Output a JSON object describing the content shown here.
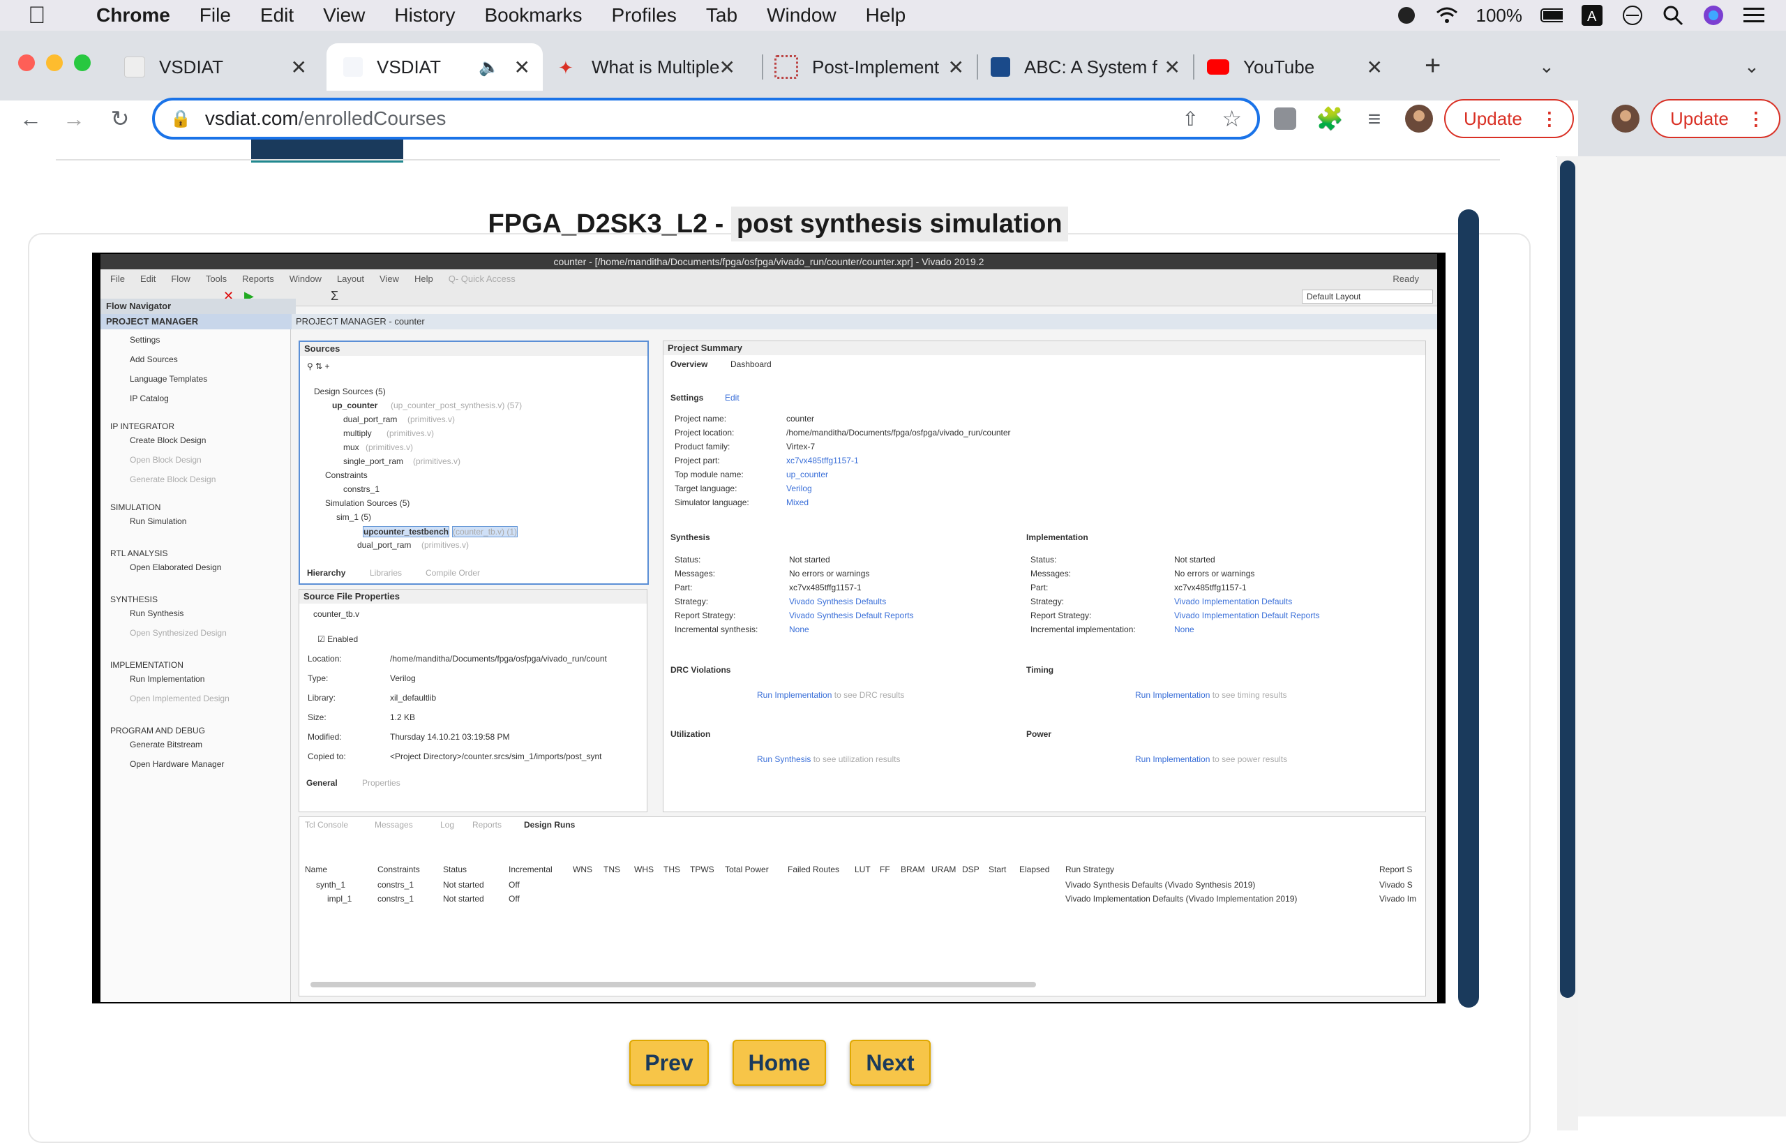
{
  "menubar": {
    "app": "Chrome",
    "items": [
      "File",
      "Edit",
      "View",
      "History",
      "Bookmarks",
      "Profiles",
      "Tab",
      "Window",
      "Help"
    ],
    "battery": "100%"
  },
  "tabs": [
    {
      "title": "VSDIAT",
      "active": false
    },
    {
      "title": "VSDIAT",
      "active": true
    },
    {
      "title": "What is Multiple",
      "active": false
    },
    {
      "title": "Post-Implement",
      "active": false
    },
    {
      "title": "ABC: A System f",
      "active": false
    },
    {
      "title": "YouTube",
      "active": false
    }
  ],
  "address": {
    "domain": "vsdiat.com",
    "path": "/enrolledCourses"
  },
  "update_label": "Update",
  "lesson": {
    "title_prefix": "FPGA_D2SK3_L2 - ",
    "title_highlight": "post synthesis simulation"
  },
  "nav": {
    "prev": "Prev",
    "home": "Home",
    "next": "Next"
  },
  "vivado": {
    "title": "counter - [/home/manditha/Documents/fpga/osfpga/vivado_run/counter/counter.xpr] - Vivado 2019.2",
    "menu": [
      "File",
      "Edit",
      "Flow",
      "Tools",
      "Reports",
      "Window",
      "Layout",
      "View",
      "Help"
    ],
    "quick_access": "Q- Quick Access",
    "status": "Ready",
    "layout": "Default Layout",
    "flow_navigator": "Flow Navigator",
    "project_manager_header": "PROJECT MANAGER - counter",
    "fn_sections": [
      {
        "title": "PROJECT MANAGER",
        "items": [
          "Settings",
          "Add Sources",
          "Language Templates",
          "IP Catalog"
        ]
      },
      {
        "title": "IP INTEGRATOR",
        "items": [
          "Create Block Design",
          "Open Block Design",
          "Generate Block Design"
        ]
      },
      {
        "title": "SIMULATION",
        "items": [
          "Run Simulation"
        ]
      },
      {
        "title": "RTL ANALYSIS",
        "items": [
          "Open Elaborated Design"
        ]
      },
      {
        "title": "SYNTHESIS",
        "items": [
          "Run Synthesis",
          "Open Synthesized Design"
        ]
      },
      {
        "title": "IMPLEMENTATION",
        "items": [
          "Run Implementation",
          "Open Implemented Design"
        ]
      },
      {
        "title": "PROGRAM AND DEBUG",
        "items": [
          "Generate Bitstream",
          "Open Hardware Manager"
        ]
      }
    ],
    "sources": {
      "title": "Sources",
      "design_sources": "Design Sources (5)",
      "top": "up_counter",
      "top_file": "(up_counter_post_synthesis.v) (57)",
      "children": [
        {
          "name": "dual_port_ram",
          "file": "(primitives.v)"
        },
        {
          "name": "multiply",
          "file": "(primitives.v)"
        },
        {
          "name": "mux",
          "file": "(primitives.v)"
        },
        {
          "name": "single_port_ram",
          "file": "(primitives.v)"
        }
      ],
      "constraints": "Constraints",
      "constrs": "constrs_1",
      "sim_sources": "Simulation Sources (5)",
      "sim1": "sim_1 (5)",
      "tb": "upcounter_testbench",
      "tb_file": "(counter_tb.v) (1)",
      "sim_child": "dual_port_ram",
      "sim_child_file": "(primitives.v)",
      "tabs": [
        "Hierarchy",
        "Libraries",
        "Compile Order"
      ]
    },
    "sfp": {
      "title": "Source File Properties",
      "file": "counter_tb.v",
      "enabled": "Enabled",
      "rows": [
        {
          "k": "Location:",
          "v": "/home/manditha/Documents/fpga/osfpga/vivado_run/count"
        },
        {
          "k": "Type:",
          "v": "Verilog"
        },
        {
          "k": "Library:",
          "v": "xil_defaultlib"
        },
        {
          "k": "Size:",
          "v": "1.2 KB"
        },
        {
          "k": "Modified:",
          "v": "Thursday 14.10.21 03:19:58 PM"
        },
        {
          "k": "Copied to:",
          "v": "<Project Directory>/counter.srcs/sim_1/imports/post_synt"
        }
      ],
      "tabs": [
        "General",
        "Properties"
      ]
    },
    "summary": {
      "title": "Project Summary",
      "tabs": [
        "Overview",
        "Dashboard"
      ],
      "settings": "Settings",
      "edit": "Edit",
      "rows": [
        {
          "k": "Project name:",
          "v": "counter"
        },
        {
          "k": "Project location:",
          "v": "/home/manditha/Documents/fpga/osfpga/vivado_run/counter"
        },
        {
          "k": "Product family:",
          "v": "Virtex-7"
        },
        {
          "k": "Project part:",
          "v": "xc7vx485tffg1157-1"
        },
        {
          "k": "Top module name:",
          "v": "up_counter"
        },
        {
          "k": "Target language:",
          "v": "Verilog"
        },
        {
          "k": "Simulator language:",
          "v": "Mixed"
        }
      ],
      "synthesis": {
        "title": "Synthesis",
        "rows": [
          {
            "k": "Status:",
            "v": "Not started"
          },
          {
            "k": "Messages:",
            "v": "No errors or warnings"
          },
          {
            "k": "Part:",
            "v": "xc7vx485tffg1157-1"
          },
          {
            "k": "Strategy:",
            "v": "Vivado Synthesis Defaults"
          },
          {
            "k": "Report Strategy:",
            "v": "Vivado Synthesis Default Reports"
          },
          {
            "k": "Incremental synthesis:",
            "v": "None"
          }
        ]
      },
      "implementation": {
        "title": "Implementation",
        "rows": [
          {
            "k": "Status:",
            "v": "Not started"
          },
          {
            "k": "Messages:",
            "v": "No errors or warnings"
          },
          {
            "k": "Part:",
            "v": "xc7vx485tffg1157-1"
          },
          {
            "k": "Strategy:",
            "v": "Vivado Implementation Defaults"
          },
          {
            "k": "Report Strategy:",
            "v": "Vivado Implementation Default Reports"
          },
          {
            "k": "Incremental implementation:",
            "v": "None"
          }
        ]
      },
      "drc": "DRC Violations",
      "timing": "Timing",
      "utilization": "Utilization",
      "power": "Power",
      "drc_link": "Run Implementation",
      "drc_text": "to see DRC results",
      "timing_link": "Run Implementation",
      "timing_text": "to see timing results",
      "util_link": "Run Synthesis",
      "util_text": "to see utilization results",
      "power_link": "Run Implementation",
      "power_text": "to see power results"
    },
    "bottom": {
      "tabs": [
        "Tcl Console",
        "Messages",
        "Log",
        "Reports",
        "Design Runs"
      ],
      "columns": [
        "Name",
        "Constraints",
        "Status",
        "Incremental",
        "WNS",
        "TNS",
        "WHS",
        "THS",
        "TPWS",
        "Total Power",
        "Failed Routes",
        "LUT",
        "FF",
        "BRAM",
        "URAM",
        "DSP",
        "Start",
        "Elapsed",
        "Run Strategy",
        "Report S"
      ],
      "rows": [
        {
          "name": "synth_1",
          "constraints": "constrs_1",
          "status": "Not started",
          "incremental": "Off",
          "strategy": "Vivado Synthesis Defaults (Vivado Synthesis 2019)",
          "report": "Vivado S"
        },
        {
          "name": "impl_1",
          "constraints": "constrs_1",
          "status": "Not started",
          "incremental": "Off",
          "strategy": "Vivado Implementation Defaults (Vivado Implementation 2019)",
          "report": "Vivado Im"
        }
      ]
    }
  }
}
